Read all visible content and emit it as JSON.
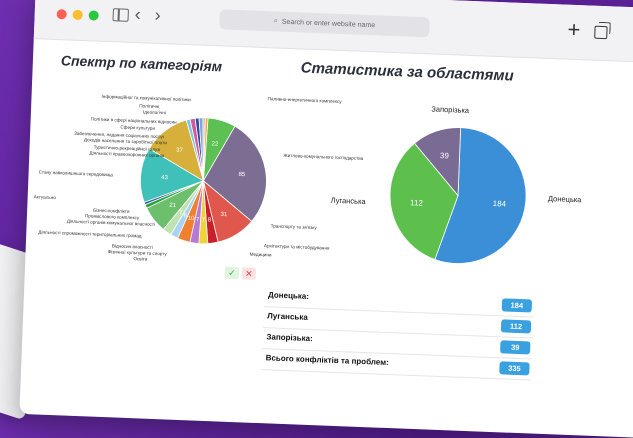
{
  "browser": {
    "address_placeholder": "Search or enter website name",
    "plus_label": "+",
    "back_label": "‹",
    "forward_label": "›"
  },
  "titles": {
    "categories": "Спектр по категоріям",
    "regions": "Статистика за областями"
  },
  "chart_data": [
    {
      "type": "pie",
      "title": "Спектр по категоріям",
      "slices": [
        {
          "label": "Паливно-енергетичного комплексу",
          "value": 22,
          "color": "#5cc052"
        },
        {
          "label": "Житлово-комунального господарства",
          "value": 85,
          "color": "#7c6d93"
        },
        {
          "label": "Транспорту та зв'язку",
          "value": 31,
          "color": "#e0584d"
        },
        {
          "label": "Архітектури та містобудування",
          "value": 8,
          "color": "#c81f2a"
        },
        {
          "label": "Медицини",
          "value": 7,
          "color": "#f0d23d"
        },
        {
          "label": "Освіти",
          "value": 7,
          "color": "#b77ad4"
        },
        {
          "label": "Фізичної культури та спорту",
          "value": 10,
          "color": "#f08030"
        },
        {
          "label": "Відносин власності",
          "value": 6,
          "color": "#a8d3f3"
        },
        {
          "label": "Діяльності спроможності територіальних громад",
          "value": 7,
          "color": "#bfe3b0"
        },
        {
          "label": "Промислового комплексу",
          "value": 21,
          "color": "#6cbf6c"
        },
        {
          "label": "Бізнес-конфлікти",
          "value": 3,
          "color": "#25a63a"
        },
        {
          "label": "Актуально",
          "value": 2,
          "color": "#3a5998"
        },
        {
          "label": "Стану навколишнього середовища",
          "value": 43,
          "color": "#3fc0b8"
        },
        {
          "label": "Діяльності правоохоронних органів",
          "value": 37,
          "color": "#d6b03a"
        },
        {
          "label": "Туристично-рекреаційної галузі",
          "value": 3,
          "color": "#7ec3e8"
        },
        {
          "label": "Сфери культури",
          "value": 4,
          "color": "#d05d9a"
        },
        {
          "label": "Політики в сфері національних відносин",
          "value": 3,
          "color": "#2d4aa0"
        },
        {
          "label": "Політичні",
          "value": 3,
          "color": "#8a9fd6"
        },
        {
          "label": "Інформаційної та комунікативної політики",
          "value": 2,
          "color": "#c8c8c8"
        },
        {
          "label": "",
          "value": 2,
          "color": "#f5a623"
        }
      ]
    },
    {
      "type": "pie",
      "title": "Статистика за областями",
      "slices": [
        {
          "label": "Донецька",
          "value": 184,
          "color": "#3a8fd6"
        },
        {
          "label": "Луганська",
          "value": 112,
          "color": "#5dc04c"
        },
        {
          "label": "Запорізька",
          "value": 39,
          "color": "#7a6b95"
        }
      ]
    }
  ],
  "category_labels": {
    "left": [
      "Інформаційної та комунікативної політики",
      "Політичні",
      "Ідеологічні",
      "Політики в сфері національних відносин",
      "Сфери культури",
      "Забезпечення, надання соціальних послуг",
      "Доходів населення та заробітної плати",
      "Туристично-рекреаційної галузі",
      "Діяльності правоохоронних органів",
      "Стану навколишнього середовища",
      "Актуально",
      "Бізнес-конфлікти",
      "Промислового комплексу",
      "Діяльності органів комунальної власності",
      "Діяльності спроможності територіальних громад",
      "Відносин власності",
      "Фізичної культури та спорту",
      "Освіти"
    ],
    "right": [
      "Паливно-енергетичного комплексу",
      "Житлово-комунального господарства",
      "Транспорту та зв'язку",
      "Архітектури та містобудування",
      "Медицини"
    ]
  },
  "actions": {
    "ok": "✓",
    "cancel": "✕"
  },
  "stats": [
    {
      "label": "Донецька:",
      "value": "184"
    },
    {
      "label": "Луганська",
      "value": "112"
    },
    {
      "label": "Запорізька:",
      "value": "39"
    },
    {
      "label": "Всього конфліктів та проблем:",
      "value": "335"
    }
  ]
}
